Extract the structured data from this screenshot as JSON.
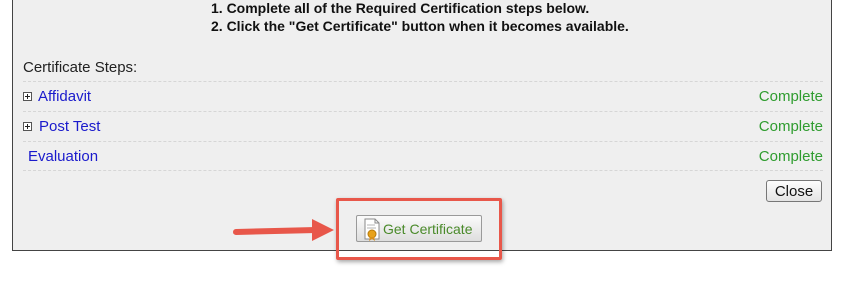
{
  "instructions": {
    "line1": "1. Complete all of the Required Certification steps below.",
    "line2": "2. Click the \"Get Certificate\" button when it becomes available."
  },
  "steps_heading": "Certificate Steps:",
  "steps": [
    {
      "label": "Affidavit",
      "status": "Complete",
      "expandable": true
    },
    {
      "label": "Post Test",
      "status": "Complete",
      "expandable": true
    },
    {
      "label": "Evaluation",
      "status": "Complete",
      "expandable": false
    }
  ],
  "close_label": "Close",
  "get_certificate_label": "Get Certificate",
  "colors": {
    "link": "#1a1acc",
    "status_complete": "#2f9c2f",
    "highlight": "#e8574a",
    "panel_bg": "#efefef"
  },
  "icons": {
    "expander": "plus-box-icon",
    "certificate": "certificate-ribbon-icon",
    "annotation": "arrow-right-icon"
  }
}
